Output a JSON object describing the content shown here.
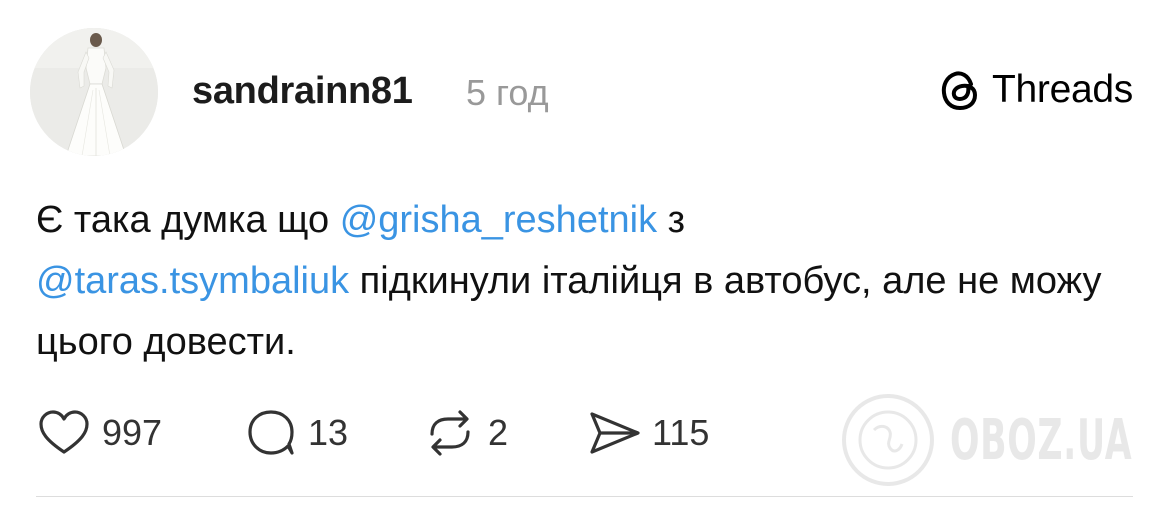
{
  "post": {
    "username": "sandrainn81",
    "timestamp": "5 год",
    "brand": "Threads",
    "text": {
      "part1": "Є така думка що ",
      "mention1": "@grisha_reshetnik",
      "part2": " з ",
      "mention2": "@taras.tsymbaliuk",
      "part3": "  підкинули італійця в автобус, але не можу цього довести."
    },
    "actions": {
      "likes": "997",
      "comments": "13",
      "reposts": "2",
      "shares": "115"
    },
    "watermark": "OBOZ.UA",
    "colors": {
      "mention": "#3a94e3",
      "timestamp": "#999999"
    },
    "icons": {
      "avatar": "profile-photo-white-dress",
      "brand": "threads-logo-icon",
      "like": "heart-icon",
      "comment": "comment-bubble-icon",
      "repost": "repost-arrows-icon",
      "share": "send-paper-plane-icon",
      "watermark": "globe-icon"
    }
  }
}
